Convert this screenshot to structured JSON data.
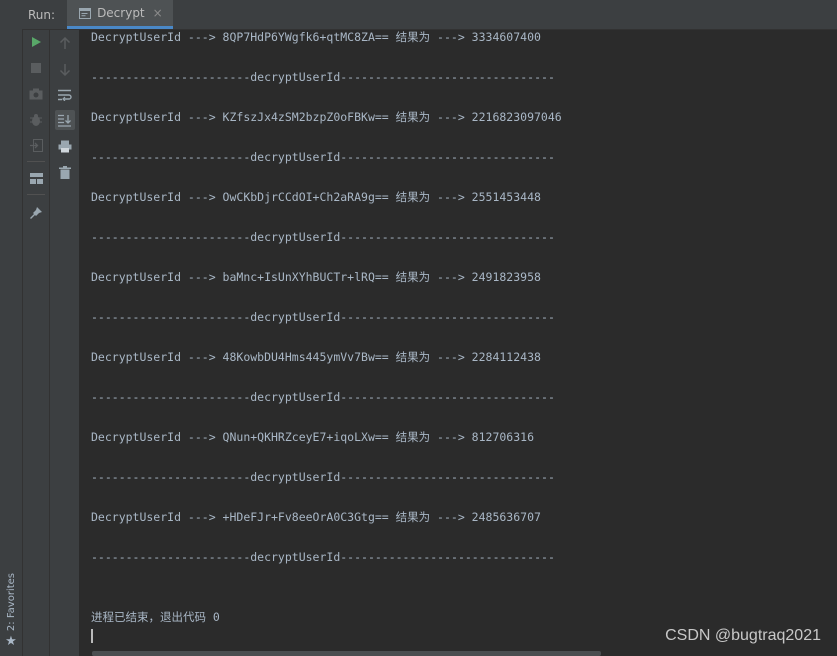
{
  "window": {
    "run_label": "Run:",
    "tab_label": "Decrypt",
    "tab_close": "×"
  },
  "sidebar": {
    "favorites_label": "2: Favorites",
    "favorites_icon": "star-icon"
  },
  "toolbar": {
    "left": [
      "run-icon",
      "stop-icon",
      "camera-icon",
      "debug-icon",
      "exit-icon",
      "layout-icon",
      "pin-icon"
    ],
    "right": [
      "up-arrow-icon",
      "down-arrow-icon",
      "soft-wrap-icon",
      "scroll-to-end-icon",
      "print-icon",
      "trash-icon"
    ]
  },
  "console": {
    "lines": [
      "DecryptUserId ---> 8QP7HdP6YWgfk6+qtMC8ZA== 结果为 ---> 3334607400",
      "-----------------------decryptUserId-------------------------------",
      "DecryptUserId ---> KZfszJx4zSM2bzpZ0oFBKw== 结果为 ---> 2216823097046",
      "-----------------------decryptUserId-------------------------------",
      "DecryptUserId ---> OwCKbDjrCCdOI+Ch2aRA9g== 结果为 ---> 2551453448",
      "-----------------------decryptUserId-------------------------------",
      "DecryptUserId ---> baMnc+IsUnXYhBUCTr+lRQ== 结果为 ---> 2491823958",
      "-----------------------decryptUserId-------------------------------",
      "DecryptUserId ---> 48KowbDU4Hms445ymVv7Bw== 结果为 ---> 2284112438",
      "-----------------------decryptUserId-------------------------------",
      "DecryptUserId ---> QNun+QKHRZceyE7+iqoLXw== 结果为 ---> 812706316",
      "-----------------------decryptUserId-------------------------------",
      "DecryptUserId ---> +HDeFJr+Fv8eeOrA0C3Gtg== 结果为 ---> 2485636707",
      "-----------------------decryptUserId-------------------------------",
      "进程已结束，退出代码 0"
    ]
  },
  "watermark": "CSDN @bugtraq2021",
  "colors": {
    "accent": "#4a88c7",
    "run_green": "#59a869",
    "text": "#a9b7c6"
  }
}
